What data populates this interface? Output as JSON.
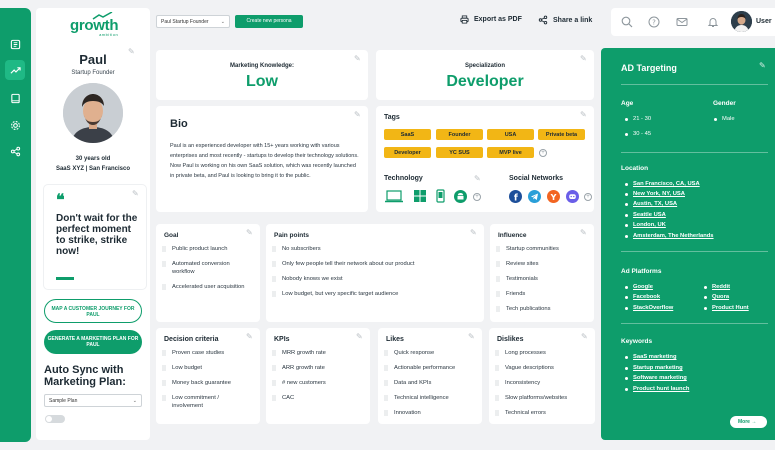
{
  "top": {
    "persona_select": "Paul Startup Founder",
    "new_persona": "Create new persona",
    "export": "Export as PDF",
    "share": "Share a link",
    "user": "User"
  },
  "profile": {
    "logo": "growth",
    "logo_sub": "ambition",
    "name": "Paul",
    "role": "Startup Founder",
    "age": "30 years old",
    "company": "SaaS XYZ | San Francisco",
    "quote": "Don't wait for the perfect moment to strike, strike now!",
    "map_button": "MAP A CUSTOMER JOURNEY FOR PAUL",
    "plan_button": "GENERATE A MARKETING PLAN FOR PAUL",
    "sync_title": "Auto Sync with Marketing Plan:",
    "sync_select": "Sample Plan"
  },
  "knowledge": {
    "label": "Marketing Knowledge:",
    "value": "Low"
  },
  "specialization": {
    "label": "Specialization",
    "value": "Developer"
  },
  "bio": {
    "title": "Bio",
    "text": "Paul is an experienced developer with 15+ years working with various enterprises and most recently - startups to develop their technology solutions. Now Paul is working on his own SaaS solution, which was recently launched in private beta, and Paul is looking to bring it to the public."
  },
  "tags": {
    "title": "Tags",
    "items": [
      "SaaS",
      "Founder",
      "USA",
      "Private beta",
      "Developer",
      "YC SUS",
      "MVP live"
    ]
  },
  "technology": {
    "title": "Technology"
  },
  "social": {
    "title": "Social Networks"
  },
  "goal": {
    "title": "Goal",
    "items": [
      "Public product launch",
      "Automated conversion workflow",
      "Accelerated user acquisition"
    ]
  },
  "pain": {
    "title": "Pain points",
    "items": [
      "No subscribers",
      "Only few people tell their network about our product",
      "Nobody knows we exist",
      "Low budget, but very specific target audience"
    ]
  },
  "influence": {
    "title": "Influence",
    "items": [
      "Startup communities",
      "Review sites",
      "Testimonials",
      "Friends",
      "Tech publications"
    ]
  },
  "decision": {
    "title": "Decision criteria",
    "items": [
      "Proven case studies",
      "Low budget",
      "Money back guarantee",
      "Low commitment / involvement"
    ]
  },
  "kpis": {
    "title": "KPIs",
    "items": [
      "MRR growth rate",
      "ARR growth rate",
      "# new customers",
      "CAC"
    ]
  },
  "likes": {
    "title": "Likes",
    "items": [
      "Quick response",
      "Actionable performance",
      "Data and KPIs",
      "Technical intelligence",
      "Innovation"
    ]
  },
  "dislikes": {
    "title": "Dislikes",
    "items": [
      "Long processes",
      "Vague descriptions",
      "Inconsistency",
      "Slow platforms/websites",
      "Technical errors"
    ]
  },
  "ad": {
    "title": "AD Targeting",
    "age_title": "Age",
    "ages": [
      "21 - 30",
      "30 - 45"
    ],
    "gender_title": "Gender",
    "gender": "Male",
    "location_title": "Location",
    "locations": [
      "San Francisco, CA, USA",
      "New York, NY, USA",
      "Austin, TX, USA",
      "Seattle USA",
      "London, UK",
      "Amsterdam, The Netherlands"
    ],
    "platforms_title": "Ad Platforms",
    "platforms_left": [
      "Google",
      "Facebook",
      "StackOverflow"
    ],
    "platforms_right": [
      "Reddit",
      "Quora",
      "Product Hunt"
    ],
    "keywords_title": "Keywords",
    "keywords": [
      "SaaS marketing",
      "Startup marketing",
      "Software marketing",
      "Product hunt launch"
    ],
    "more": "More"
  }
}
